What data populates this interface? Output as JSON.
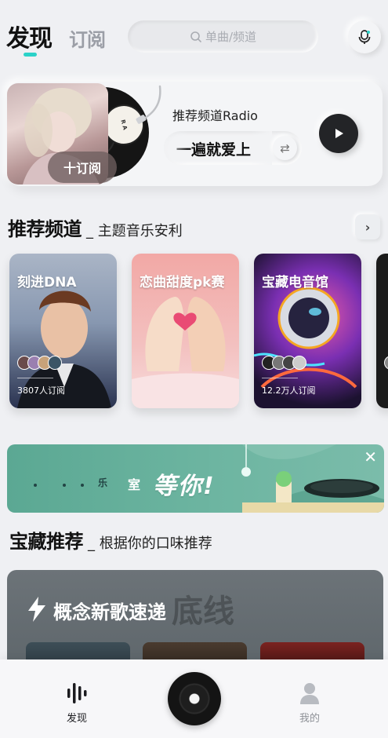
{
  "header": {
    "tab_discover": "发现",
    "tab_subscribe": "订阅",
    "search_placeholder": "单曲/频道"
  },
  "radio": {
    "label": "推荐频道Radio",
    "song_title": "一遍就爱上",
    "subscribe_label": "十订阅"
  },
  "recommended": {
    "title": "推荐频道",
    "subtitle": "_ 主题音乐安利",
    "cards": [
      {
        "title": "刻进DNA",
        "count": "3807人订阅"
      },
      {
        "title": "恋曲甜度pk赛",
        "count": ""
      },
      {
        "title": "宝藏电音馆",
        "count": "12.2万人订阅"
      }
    ]
  },
  "banner": {
    "word1": "乐",
    "word2": "室",
    "headline": "等你!"
  },
  "treasure": {
    "title": "宝藏推荐",
    "subtitle": "_ 根据你的口味推荐",
    "card_title": "概念新歌速递",
    "bg_text": "底线"
  },
  "nav": {
    "discover": "发现",
    "mine": "我的"
  },
  "colors": {
    "accent": "#2bd2c8",
    "background": "#eff0f3",
    "banner": "#5ba893"
  }
}
